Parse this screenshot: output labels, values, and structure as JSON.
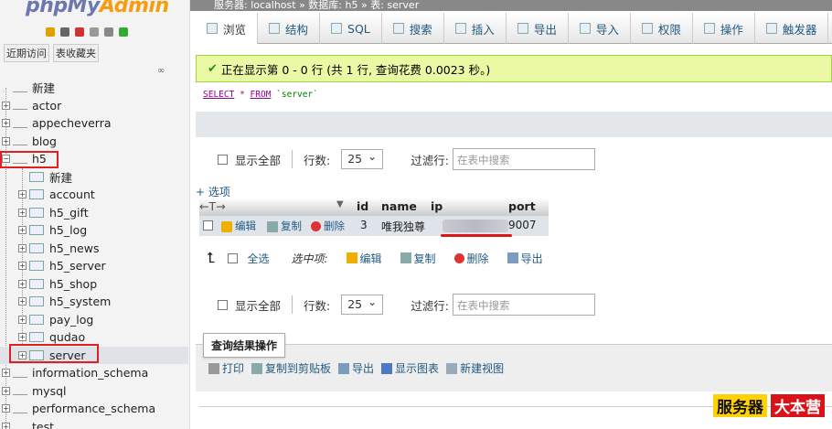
{
  "sidebar": {
    "logo_main": "phpMy",
    "logo_accent": "Admin",
    "recent_tabs": [
      "近期访问",
      "表收藏夹"
    ],
    "collapse_label": "∞",
    "databases": [
      {
        "label": "新建",
        "type": "new"
      },
      {
        "label": "actor",
        "type": "db"
      },
      {
        "label": "appecheverra",
        "type": "db"
      },
      {
        "label": "blog",
        "type": "db"
      },
      {
        "label": "h5",
        "type": "db",
        "expanded": true
      },
      {
        "label": "新建",
        "type": "new",
        "sub": true
      },
      {
        "label": "account",
        "type": "table",
        "sub": true
      },
      {
        "label": "h5_gift",
        "type": "table",
        "sub": true
      },
      {
        "label": "h5_log",
        "type": "table",
        "sub": true
      },
      {
        "label": "h5_news",
        "type": "table",
        "sub": true
      },
      {
        "label": "h5_server",
        "type": "table",
        "sub": true
      },
      {
        "label": "h5_shop",
        "type": "table",
        "sub": true
      },
      {
        "label": "h5_system",
        "type": "table",
        "sub": true
      },
      {
        "label": "pay_log",
        "type": "table",
        "sub": true
      },
      {
        "label": "qudao",
        "type": "table",
        "sub": true
      },
      {
        "label": "server",
        "type": "table",
        "sub": true,
        "selected": true
      },
      {
        "label": "information_schema",
        "type": "db"
      },
      {
        "label": "mysql",
        "type": "db"
      },
      {
        "label": "performance_schema",
        "type": "db"
      },
      {
        "label": "test",
        "type": "db"
      }
    ]
  },
  "breadcrumb": "服务器: localhost » 数据库: h5 » 表: server",
  "tabs": [
    "浏览",
    "结构",
    "SQL",
    "搜索",
    "插入",
    "导出",
    "导入",
    "权限",
    "操作",
    "触发器"
  ],
  "success_message": "正在显示第 0 - 0 行 (共 1 行, 查询花费 0.0023 秒。)",
  "sql": {
    "kw1": "SELECT",
    "star": "*",
    "kw2": "FROM",
    "table": "`server`"
  },
  "nav": {
    "show_all": "显示全部",
    "rows_label": "行数:",
    "rows_value": "25",
    "filter_label": "过滤行:",
    "filter_placeholder": "在表中搜索"
  },
  "options_link": "+ 选项",
  "arrows": "←T→",
  "sort_glyph": "▼",
  "columns": [
    "id",
    "name",
    "ip",
    "port"
  ],
  "row": {
    "edit": "编辑",
    "copy": "复制",
    "delete": "删除",
    "id": "3",
    "name": "唯我独尊",
    "ip": "",
    "port": "9007"
  },
  "selection": {
    "select_all": "全选",
    "with_selected": "选中项:",
    "edit": "编辑",
    "copy": "复制",
    "delete": "删除",
    "export": "导出"
  },
  "query_ops": {
    "title": "查询结果操作",
    "print": "打印",
    "copy_clipboard": "复制到剪贴板",
    "export": "导出",
    "show_chart": "显示图表",
    "create_view": "新建视图"
  },
  "watermark": [
    "服务器",
    "大本营"
  ]
}
